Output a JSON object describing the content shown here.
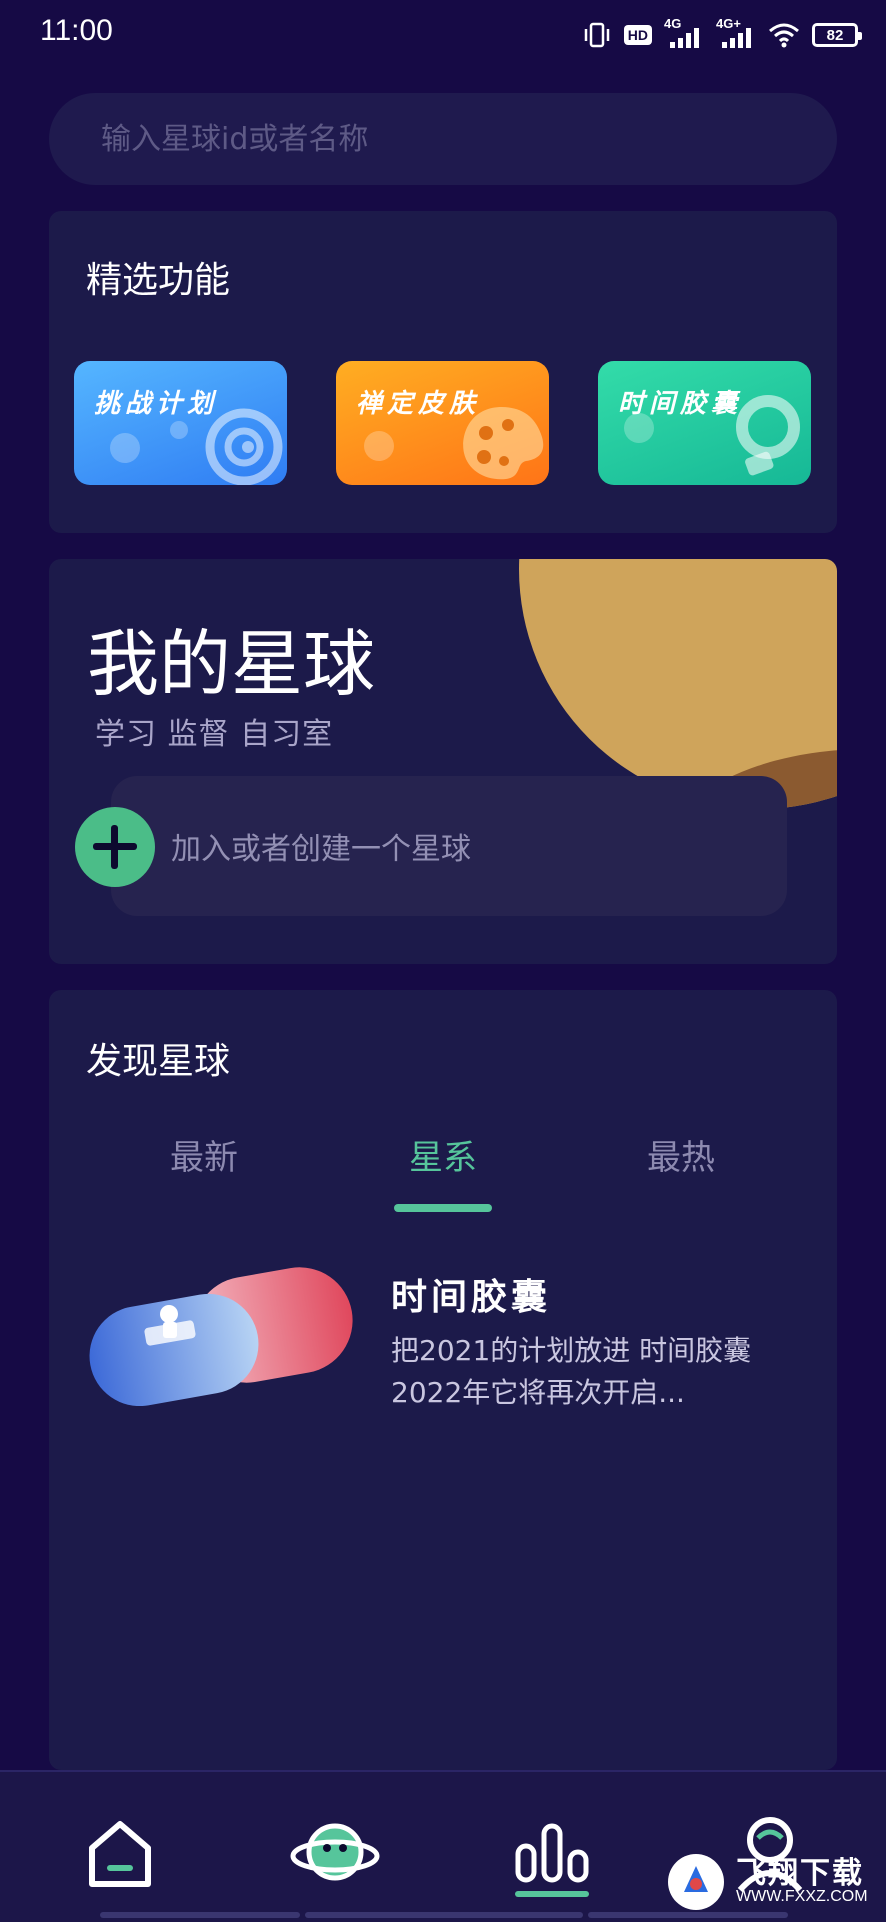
{
  "status_bar": {
    "time": "11:00",
    "battery": "82",
    "network_1": "4G",
    "network_2": "4G+",
    "hd": "HD"
  },
  "search": {
    "placeholder": "输入星球id或者名称"
  },
  "featured": {
    "title": "精选功能",
    "items": [
      {
        "label": "挑战计划",
        "icon": "target-icon",
        "color": "#3d95f8"
      },
      {
        "label": "禅定皮肤",
        "icon": "palette-icon",
        "color": "#ff8f1d"
      },
      {
        "label": "时间胶囊",
        "icon": "ring-icon",
        "color": "#20c9a0"
      }
    ]
  },
  "my_planet": {
    "title": "我的星球",
    "subtitle": "学习 监督 自习室",
    "join_label": "加入或者创建一个星球"
  },
  "discover": {
    "title": "发现星球",
    "tabs": [
      {
        "label": "最新",
        "active": false
      },
      {
        "label": "星系",
        "active": true
      },
      {
        "label": "最热",
        "active": false
      }
    ],
    "item": {
      "title": "时间胶囊",
      "desc_line1": "把2021的计划放进 时间胶囊",
      "desc_line2": "2022年它将再次开启..."
    }
  },
  "nav": {
    "items": [
      {
        "icon": "home-icon"
      },
      {
        "icon": "planet-icon"
      },
      {
        "icon": "ranking-icon",
        "active": true
      },
      {
        "icon": "profile-icon"
      }
    ]
  },
  "watermark": {
    "text": "飞翔下载",
    "url_text": "WWW.FXXZ.COM"
  },
  "colors": {
    "background": "#160a45",
    "card": "#1c1a4a",
    "accent": "#56c59b",
    "planet": "#cfa45b"
  }
}
